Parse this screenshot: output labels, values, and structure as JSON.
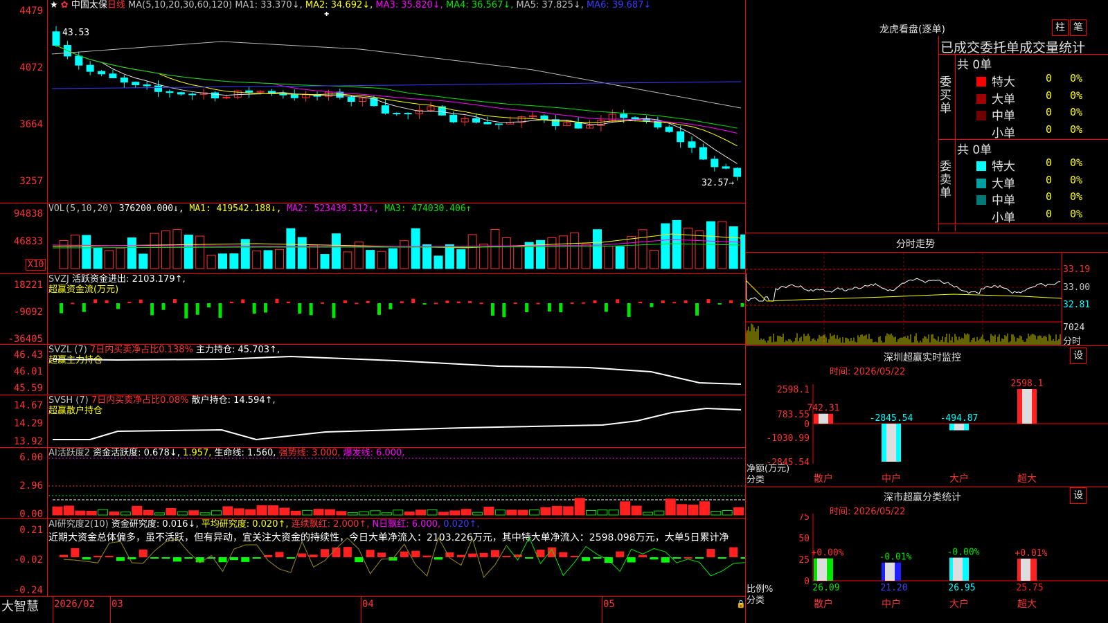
{
  "stock": {
    "star": "★",
    "name": "中国太保",
    "period": "日线"
  },
  "ma_line": {
    "label": "MA(5,10,20,30,60,120)",
    "items": [
      {
        "t": "MA1: 33.370",
        "arrow": "↓",
        "color": "#c0c0c0"
      },
      {
        "t": "MA2: 34.692",
        "arrow": "↓",
        "color": "#ffff00"
      },
      {
        "t": "MA3: 35.820",
        "arrow": "↓",
        "color": "#ff00ff"
      },
      {
        "t": "MA4: 36.567",
        "arrow": "↓",
        "color": "#00e600"
      },
      {
        "t": "MA5: 37.825",
        "arrow": "↓",
        "color": "#c0c0c0"
      },
      {
        "t": "MA6: 39.687",
        "arrow": "↓",
        "color": "#3c3cff"
      }
    ]
  },
  "price_axis": [
    "4479",
    "4072",
    "3664",
    "3257"
  ],
  "price_marks": {
    "high": "43.53",
    "low": "32.57→"
  },
  "vol_line": {
    "label": "VOL(5,10,20)",
    "value": "376200.000↓,",
    "items": [
      {
        "t": "MA1: 419542.188↓,",
        "color": "#ffff00"
      },
      {
        "t": "MA2: 523439.312↓,",
        "color": "#ff00ff"
      },
      {
        "t": "MA3: 474030.406↑",
        "color": "#00e600"
      }
    ]
  },
  "vol_axis": [
    "94838",
    "46833"
  ],
  "vol_unit": "X10",
  "svzj": {
    "label": "SVZJ",
    "name": "活跃资金进出:",
    "value": "2103.179↑,",
    "sub": "超赢资金流(万元)"
  },
  "svzj_axis": [
    "18221",
    "-9092",
    "-36405"
  ],
  "svzl": {
    "label": "SVZL (7)",
    "ratio": "7日内买卖净占比0.138%",
    "name": "主力持仓:",
    "value": "45.703↑,",
    "sub": "超赢主力持仓"
  },
  "svzl_axis": [
    "46.43",
    "46.01",
    "45.59"
  ],
  "svsh": {
    "label": "SVSH (7)",
    "ratio": "7日内买卖净占比0.08%",
    "name": "散户持仓:",
    "value": "14.594↑,",
    "sub": "超赢散户持仓"
  },
  "svsh_axis": [
    "14.67",
    "14.29",
    "13.92"
  ],
  "ai1": {
    "label": "AI活跃度2",
    "a": "资金活跃度: 0.678↓,",
    "b": "1.957,",
    "c": "生命线: 1.560,",
    "d": "强势线: 3.000,",
    "e": "爆发线: 6.000,"
  },
  "ai1_axis": [
    "6.00",
    "2.96",
    "0.00"
  ],
  "ai2": {
    "label": "AI研究度2(10)",
    "a": "资金研究度: 0.016↓,",
    "b": "平均研究度: 0.020↑,",
    "c": "连续飘红: 2.000↑,",
    "d": "N日飘红: 6.000,",
    "e": "0.020↑,"
  },
  "ai2_comment": "近期大资金总体偏多，虽不活跃，但有异动，宜关注大资金的持续性，今日大单净流入：2103.226万元，其中特大单净流入：2598.098万元，大单5日累计净",
  "ai2_axis": [
    "0.21",
    "-0.02",
    "-0.24"
  ],
  "footer": {
    "brand": "大智慧",
    "dates": [
      "2026/02",
      "03",
      "04",
      "05"
    ]
  },
  "right": {
    "lh_title": "龙虎看盘(逐单)",
    "btn_zhu": "柱",
    "btn_bi": "笔",
    "lh_header": "已成交委托单成交量统计",
    "buy_label": "委买单",
    "sell_label": "委卖单",
    "buy_total": "共 0单",
    "sell_total": "共 0单",
    "buy_rows": [
      {
        "name": "特大",
        "n": "0",
        "p": "0%",
        "color": "#ff0000"
      },
      {
        "name": "大单",
        "n": "0",
        "p": "0%",
        "color": "#a00000"
      },
      {
        "name": "中单",
        "n": "0",
        "p": "0%",
        "color": "#6e0000"
      },
      {
        "name": "小单",
        "n": "0",
        "p": "0%",
        "color": ""
      }
    ],
    "sell_rows": [
      {
        "name": "特大",
        "n": "0",
        "p": "0%",
        "color": "#00ffff"
      },
      {
        "name": "大单",
        "n": "0",
        "p": "0%",
        "color": "#00a0a0"
      },
      {
        "name": "中单",
        "n": "0",
        "p": "0%",
        "color": "#007878"
      },
      {
        "name": "小单",
        "n": "0",
        "p": "0%",
        "color": ""
      }
    ],
    "fs_title": "分时走势",
    "fs_axis": [
      "33.19",
      "33.00",
      "32.81"
    ],
    "fs_vol": "7024",
    "fs_unit": "分时",
    "sz_title": "深圳超赢实时监控",
    "sz_btn": "设",
    "sz_time": "时间: 2026/05/22",
    "sz_axis": [
      "2598.1",
      "783.55",
      "0",
      "-1030.99",
      "-2845.54"
    ],
    "sz_ylabel": "净额(万元)",
    "sz_xlabel": "分类",
    "sz_bars": [
      {
        "cat": "散户",
        "val": "742.31"
      },
      {
        "cat": "中户",
        "val": "-2845.54"
      },
      {
        "cat": "大户",
        "val": "-494.87"
      },
      {
        "cat": "超大",
        "val": "2598.1"
      }
    ],
    "sc_title": "深市超赢分类统计",
    "sc_btn": "设",
    "sc_time": "时间: 2026/05/22",
    "sc_axis": [
      "75",
      "50",
      "25",
      "0"
    ],
    "sc_ylabel": "比例%",
    "sc_xlabel": "分类",
    "sc_bars": [
      {
        "cat": "散户",
        "chg": "+0.00%",
        "val": "26.09"
      },
      {
        "cat": "中户",
        "chg": "-0.01%",
        "val": "21.20"
      },
      {
        "cat": "大户",
        "chg": "-0.00%",
        "val": "26.95"
      },
      {
        "cat": "超大",
        "chg": "+0.01%",
        "val": "25.75"
      }
    ]
  },
  "colors": {
    "up": "#ff3232",
    "down": "#00ffff",
    "grid": "#ff0000",
    "bg": "#000000"
  }
}
